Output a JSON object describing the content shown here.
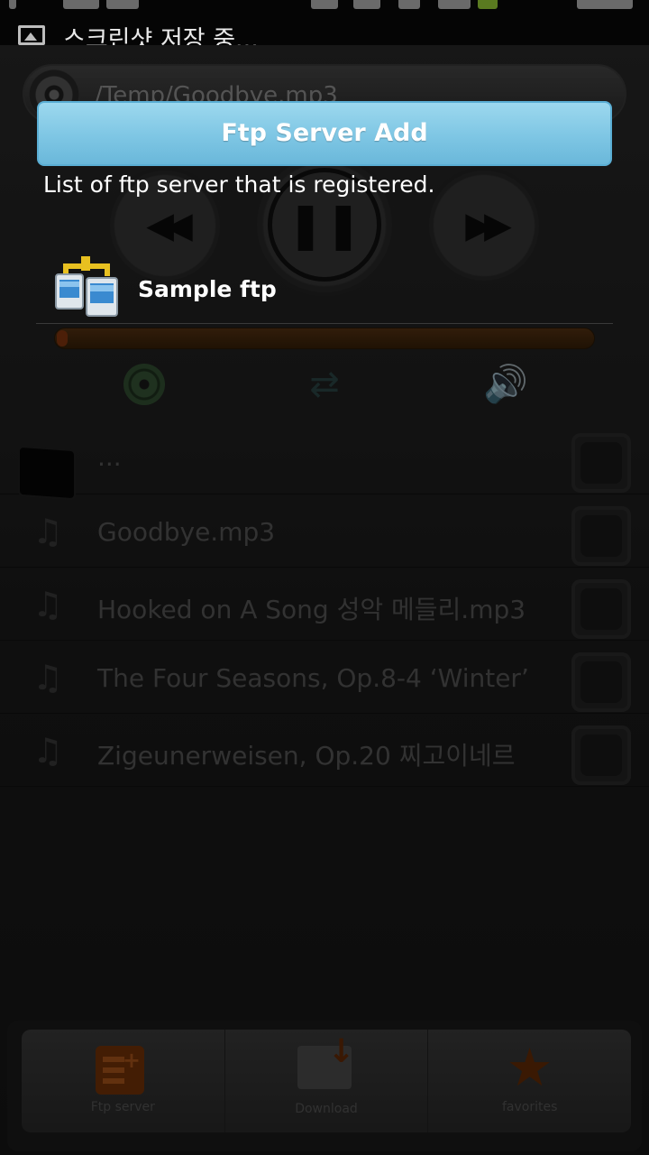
{
  "status_bar": {
    "notification_text": "스크린샷 저장 중..."
  },
  "player": {
    "path": "/Temp/Goodbye.mp3",
    "progress_percent": 2,
    "controls": {
      "prev": "◀◀",
      "pause": "❚❚",
      "next": "▶▶"
    }
  },
  "file_list": {
    "parent_label": "...",
    "items": [
      {
        "name": "Goodbye.mp3"
      },
      {
        "name": "Hooked on A Song 성악 메들리.mp3"
      },
      {
        "name": "The Four Seasons, Op.8-4 ‘Winter’"
      },
      {
        "name": "Zigeunerweisen, Op.20 찌고이네르"
      }
    ]
  },
  "bottom_bar": {
    "tabs": [
      {
        "label": "Ftp server"
      },
      {
        "label": "Download"
      },
      {
        "label": "favorites"
      }
    ]
  },
  "dialog": {
    "add_button_label": "Ftp Server Add",
    "caption": "List of ftp server that is registered.",
    "servers": [
      {
        "name": "Sample ftp"
      }
    ]
  },
  "colors": {
    "accent_button": "#7ec6e4",
    "progress": "#5a3514",
    "tab_icon_orange": "#7a3608"
  }
}
